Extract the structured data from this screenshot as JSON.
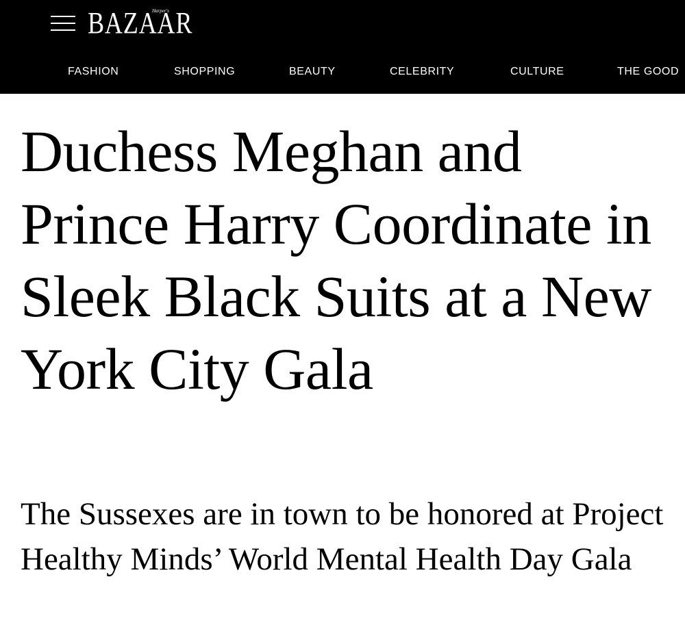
{
  "header": {
    "logo": "BAZAAR",
    "logo_small": "Harper's",
    "menu_icon": "hamburger-menu-icon",
    "nav": [
      "FASHION",
      "SHOPPING",
      "BEAUTY",
      "CELEBRITY",
      "CULTURE",
      "THE GOOD"
    ]
  },
  "article": {
    "headline": "Duchess Meghan and Prince Harry Coordinate in Sleek Black Suits at a New York City Gala",
    "dek": "The Sussexes are in town to be honored at Project Healthy Minds’ World Mental Health Day Gala"
  },
  "colors": {
    "header_bg": "#000000",
    "header_text": "#ffffff",
    "body_bg": "#ffffff",
    "body_text": "#000000"
  }
}
